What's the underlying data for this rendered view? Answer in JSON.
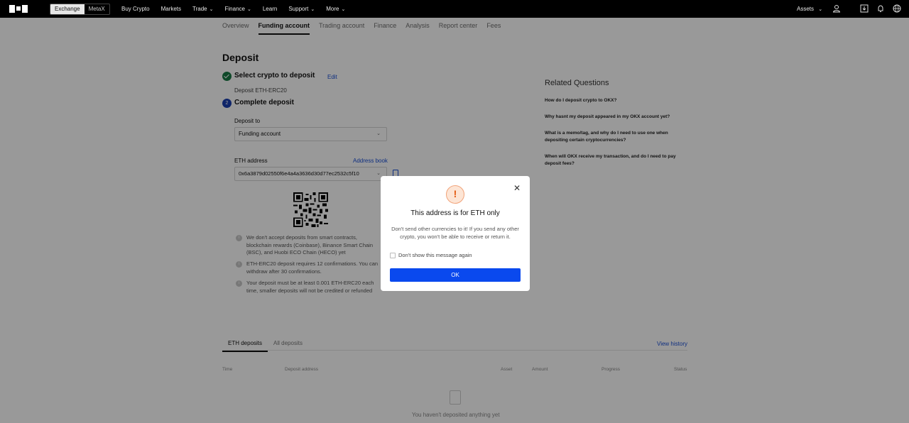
{
  "topbar": {
    "logo": "OKX",
    "segments": [
      "Exchange",
      "MetaX"
    ],
    "nav": [
      {
        "label": "Buy Crypto",
        "chev": false
      },
      {
        "label": "Markets",
        "chev": false
      },
      {
        "label": "Trade",
        "chev": true
      },
      {
        "label": "Finance",
        "chev": true
      },
      {
        "label": "Learn",
        "chev": false
      },
      {
        "label": "Support",
        "chev": true
      },
      {
        "label": "More",
        "chev": true
      }
    ],
    "assets": "Assets"
  },
  "subtabs": [
    "Overview",
    "Funding account",
    "Trading account",
    "Finance",
    "Analysis",
    "Report center",
    "Fees"
  ],
  "deposit": {
    "title": "Deposit",
    "step1": "Select crypto to deposit",
    "edit": "Edit",
    "step1_sub": "Deposit ETH-ERC20",
    "step2_num": "2",
    "step2": "Complete deposit",
    "deposit_to_label": "Deposit to",
    "deposit_to_value": "Funding account",
    "eth_address_label": "ETH address",
    "address_book": "Address book",
    "address": "0x6a3879d02550f6e4a4a3636d30d77ec2532c5f10",
    "notes": [
      "We don't accept deposits from smart contracts, blockchain rewards (Coinbase), Binance Smart Chain (BSC), and Huobi ECO Chain (HECO) yet",
      "ETH-ERC20 deposit requires 12 confirmations. You can withdraw after 30 confirmations.",
      "Your deposit must be at least 0.001 ETH-ERC20 each time, smaller deposits will not be credited or refunded"
    ]
  },
  "related": {
    "title": "Related Questions",
    "questions": [
      "How do I deposit crypto to OKX?",
      "Why hasnt my deposit appeared in my OKX account yet?",
      "What is a memo/tag, and why do I need to use one when depositing certain cryptocurrencies?",
      "When will OKX receive my transaction, and do I need to pay deposit fees?"
    ]
  },
  "history": {
    "tabs": [
      "ETH deposits",
      "All deposits"
    ],
    "view_history": "View history",
    "columns": [
      "Time",
      "Deposit address",
      "Asset",
      "Amount",
      "Progress",
      "Status"
    ],
    "empty": "You haven't deposited anything yet"
  },
  "modal": {
    "icon": "!",
    "title": "This address is for ETH only",
    "body": "Don't send other currencies to it! If you send any other crypto, you won't be able to receive or return it.",
    "checkbox_label": "Don't show this message again",
    "ok": "OK"
  }
}
